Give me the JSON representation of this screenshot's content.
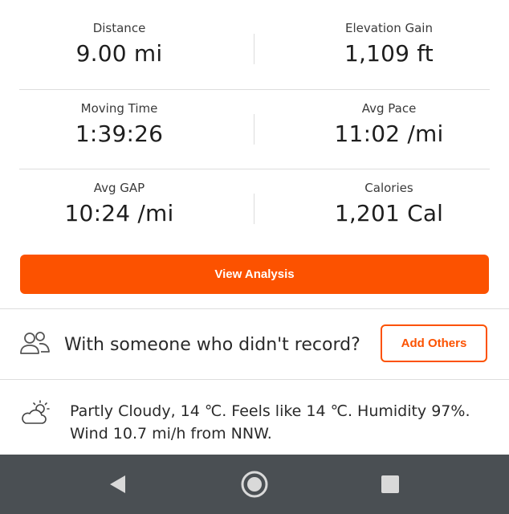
{
  "stats": {
    "distance": {
      "label": "Distance",
      "value": "9.00 mi"
    },
    "elevation": {
      "label": "Elevation Gain",
      "value": "1,109 ft"
    },
    "moving_time": {
      "label": "Moving Time",
      "value": "1:39:26"
    },
    "avg_pace": {
      "label": "Avg Pace",
      "value": "11:02 /mi"
    },
    "avg_gap": {
      "label": "Avg GAP",
      "value": "10:24 /mi"
    },
    "calories": {
      "label": "Calories",
      "value": "1,201 Cal"
    }
  },
  "view_analysis_label": "View Analysis",
  "others": {
    "prompt": "With someone who didn't record?",
    "button_label": "Add Others"
  },
  "weather": {
    "text": "Partly Cloudy, 14 ℃. Feels like 14 ℃. Humidity 97%. Wind 10.7 mi/h from NNW."
  },
  "navbar": {
    "icons": [
      "back-icon",
      "home-icon",
      "recents-icon"
    ]
  },
  "colors": {
    "accent": "#fc5200",
    "navbar": "#4a4f53",
    "divider": "#dddddd"
  }
}
